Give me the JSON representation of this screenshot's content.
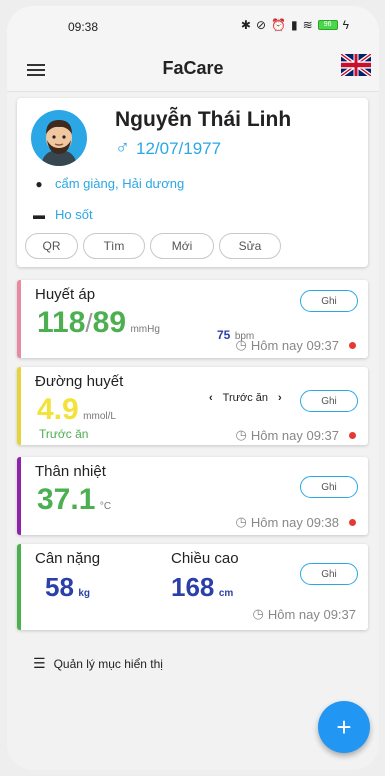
{
  "status_bar": {
    "time": "09:38",
    "battery": "96"
  },
  "app_bar": {
    "title": "FaCare"
  },
  "profile": {
    "name": "Nguyễn Thái Linh",
    "gender_symbol": "♂",
    "birthdate": "12/07/1977",
    "address": "cẩm giàng, Hải dương",
    "note": "Ho sốt",
    "buttons": [
      "QR",
      "Tìm",
      "Mới",
      "Sửa"
    ]
  },
  "blood_pressure": {
    "title": "Huyết áp",
    "systolic": "118",
    "separator": "/",
    "diastolic": "89",
    "unit": "mmHg",
    "pulse": "75",
    "pulse_unit": "bpm",
    "record_label": "Ghi",
    "time": "Hôm nay 09:37",
    "accent": "#e88aa3"
  },
  "blood_sugar": {
    "title": "Đường huyết",
    "value": "4.9",
    "unit": "mmol/L",
    "context": "Trước ăn",
    "selector_label": "Trước ăn",
    "record_label": "Ghi",
    "time": "Hôm nay 09:37",
    "accent": "#e6d53a",
    "value_color": "#f2e23a"
  },
  "temperature": {
    "title": "Thân nhiệt",
    "value": "37.1",
    "unit": "°C",
    "record_label": "Ghi",
    "time": "Hôm nay 09:38",
    "accent": "#8e24aa"
  },
  "body": {
    "weight_title": "Cân nặng",
    "weight_value": "58",
    "weight_unit": "kg",
    "height_title": "Chiều cao",
    "height_value": "168",
    "height_unit": "cm",
    "record_label": "Ghi",
    "time": "Hôm nay 09:37",
    "accent": "#4caf50",
    "value_color": "#2b3fa8"
  },
  "manage_label": "Quản lý mục hiển thị",
  "fab_label": "+",
  "icons": {
    "menu": "menu-icon",
    "flag": "uk-flag-icon",
    "location": "location-pin-icon",
    "bed": "bed-icon",
    "clock": "clock-icon",
    "list": "list-icon",
    "add": "add-icon"
  }
}
